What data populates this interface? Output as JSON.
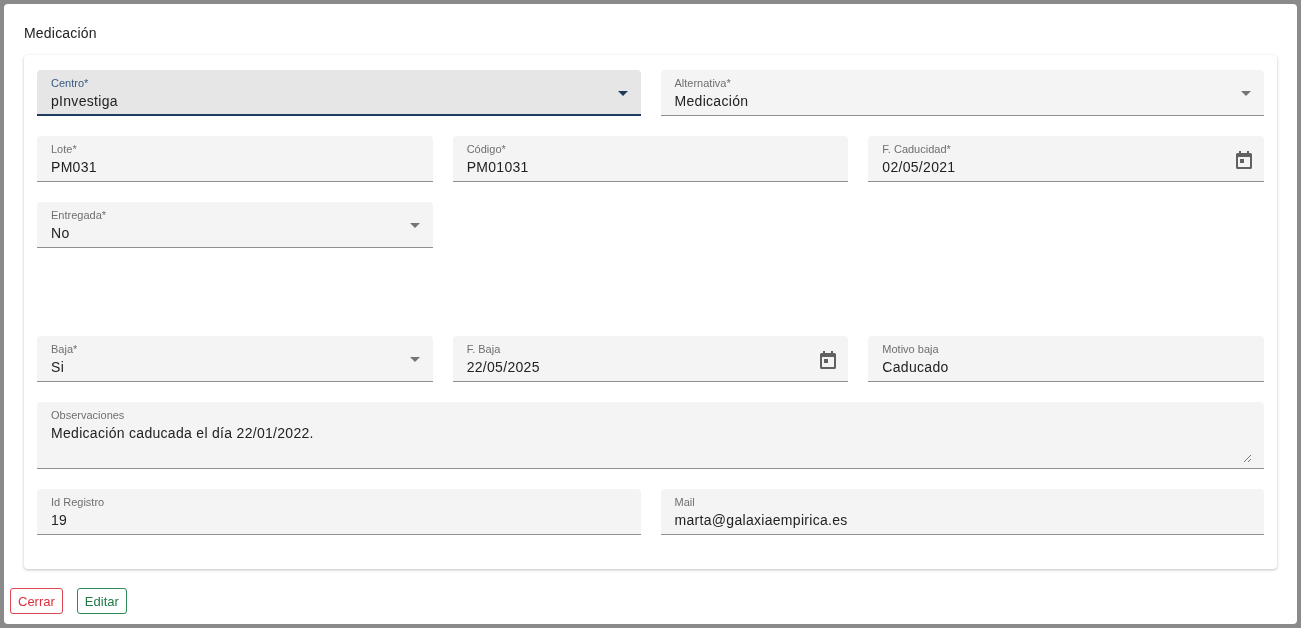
{
  "dialog": {
    "title": "Medicación"
  },
  "form_rows": [
    {
      "fields": [
        {
          "kind": "select",
          "label": "Centro*",
          "value": "pInvestiga",
          "focused": true
        },
        {
          "kind": "select",
          "label": "Alternativa*",
          "value": "Medicación",
          "focused": false
        }
      ]
    },
    {
      "fields": [
        {
          "kind": "text",
          "label": "Lote*",
          "value": "PM031",
          "focused": false
        },
        {
          "kind": "text",
          "label": "Código*",
          "value": "PM01031",
          "focused": false
        },
        {
          "kind": "date",
          "label": "F. Caducidad*",
          "value": "02/05/2021",
          "focused": false
        }
      ]
    },
    {
      "fields": [
        {
          "kind": "select",
          "label": "Entregada*",
          "value": "No",
          "focused": false
        }
      ]
    },
    {
      "fields": [
        {
          "kind": "select",
          "label": "Baja*",
          "value": "Si",
          "focused": false
        },
        {
          "kind": "date",
          "label": "F. Baja",
          "value": "22/05/2025",
          "focused": false
        },
        {
          "kind": "text",
          "label": "Motivo baja",
          "value": "Caducado",
          "focused": false
        }
      ]
    },
    {
      "fields": [
        {
          "kind": "textarea",
          "label": "Observaciones",
          "value": "Medicación caducada el día 22/01/2022.",
          "focused": false
        }
      ]
    },
    {
      "fields": [
        {
          "kind": "text",
          "label": "Id Registro",
          "value": "19",
          "focused": false
        },
        {
          "kind": "text",
          "label": "Mail",
          "value": "marta@galaxiaempirica.es",
          "focused": false
        }
      ]
    }
  ],
  "buttons": [
    {
      "kind": "danger",
      "label": "Cerrar"
    },
    {
      "kind": "success",
      "label": "Editar"
    }
  ]
}
